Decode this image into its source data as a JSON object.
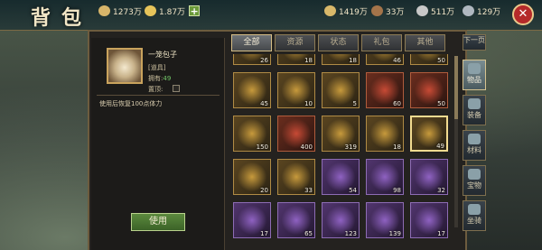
{
  "title": "背包",
  "resources": [
    {
      "value": "1273万",
      "icon": "coin-icon",
      "color": "#d7b56a"
    },
    {
      "value": "1.87万",
      "icon": "ingot-icon",
      "color": "#e6c45a"
    },
    {
      "value": "1419万",
      "icon": "grain-icon",
      "color": "#d9b86a"
    },
    {
      "value": "33万",
      "icon": "wood-icon",
      "color": "#a4744a"
    },
    {
      "value": "511万",
      "icon": "stone-icon",
      "color": "#c8c8c8"
    },
    {
      "value": "129万",
      "icon": "iron-icon",
      "color": "#b0b8c0"
    }
  ],
  "plus_label": "+",
  "close_label": "✕",
  "tabs": [
    "全部",
    "资源",
    "状态",
    "礼包",
    "其他"
  ],
  "side_tabs": [
    "下一页",
    "物品",
    "装备",
    "材料",
    "宝物",
    "坐骑"
  ],
  "detail": {
    "name": "一笼包子",
    "type": "[道具]",
    "own_label": "拥有:",
    "own_value": "49",
    "top_label": "置顶:",
    "description": "使用后恢复100点体力",
    "use_button": "使用"
  },
  "grid": [
    {
      "count": "26",
      "icon": "grain-sack-icon",
      "q": "gold"
    },
    {
      "count": "18",
      "icon": "scroll-icon",
      "q": "gold"
    },
    {
      "count": "18",
      "icon": "scroll-icon",
      "q": "gold"
    },
    {
      "count": "46",
      "icon": "box-icon",
      "q": "gold"
    },
    {
      "count": "50",
      "icon": "bag-icon",
      "q": "gold"
    },
    {
      "count": "45",
      "icon": "gold-token-icon",
      "q": "gold"
    },
    {
      "count": "10",
      "icon": "gold-token-icon",
      "q": "gold"
    },
    {
      "count": "5",
      "icon": "speed-up-icon",
      "q": "gold"
    },
    {
      "count": "60",
      "icon": "red-hat-icon",
      "q": "red"
    },
    {
      "count": "50",
      "icon": "meat-icon",
      "q": "red"
    },
    {
      "count": "150",
      "icon": "hammer-icon",
      "q": "gold"
    },
    {
      "count": "400",
      "icon": "candied-fruit-icon",
      "q": "red"
    },
    {
      "count": "319",
      "icon": "arrows-icon",
      "q": "gold"
    },
    {
      "count": "18",
      "icon": "book-icon",
      "q": "gold"
    },
    {
      "count": "49",
      "icon": "steamed-bun-icon",
      "q": "gold"
    },
    {
      "count": "20",
      "icon": "grain-sack-icon",
      "q": "gold"
    },
    {
      "count": "33",
      "icon": "scroll-icon",
      "q": "gold"
    },
    {
      "count": "54",
      "icon": "purple-book-icon",
      "q": "purple"
    },
    {
      "count": "98",
      "icon": "gold-plaque-icon",
      "q": "purple"
    },
    {
      "count": "32",
      "icon": "purple-chest-icon",
      "q": "purple"
    },
    {
      "count": "17",
      "icon": "purple-chest-icon",
      "q": "purple"
    },
    {
      "count": "65",
      "icon": "purple-chest-icon",
      "q": "purple"
    },
    {
      "count": "123",
      "icon": "purple-chest-icon",
      "q": "purple"
    },
    {
      "count": "139",
      "icon": "purple-speed-icon",
      "q": "purple"
    },
    {
      "count": "17",
      "icon": "purple-chest-icon",
      "q": "purple"
    }
  ]
}
